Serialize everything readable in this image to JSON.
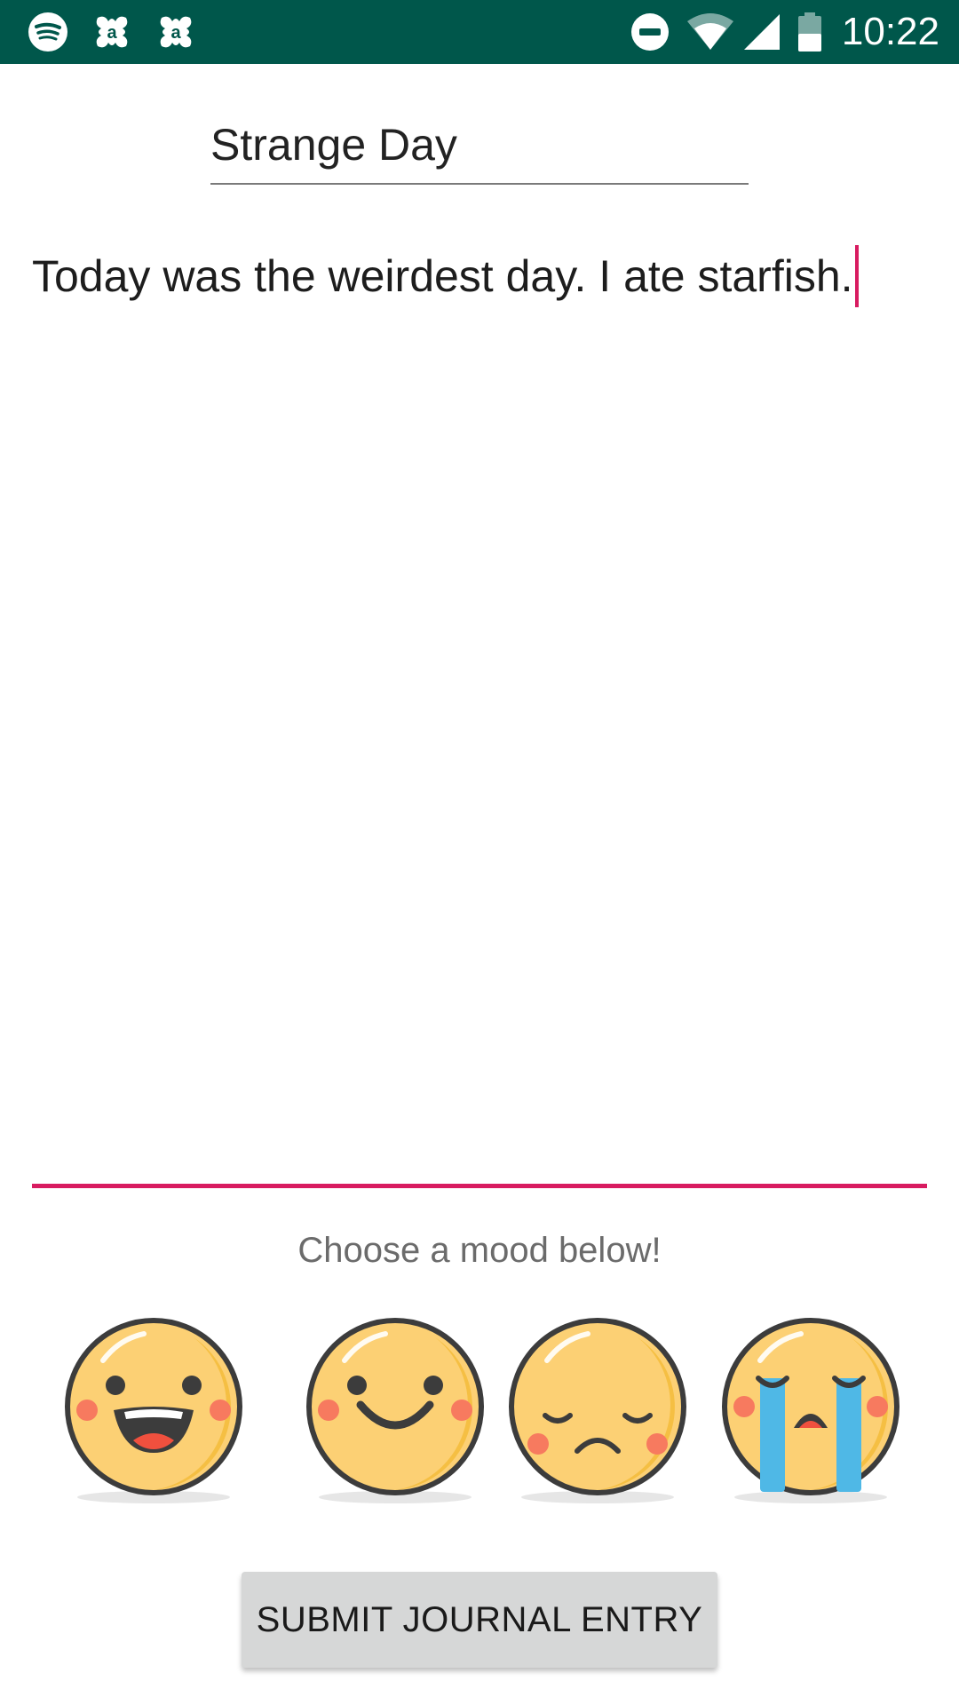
{
  "status_bar": {
    "time": "10:22",
    "left_icons": [
      "spotify-icon",
      "app-notification-icon",
      "app-notification-icon"
    ],
    "right_icons": [
      "do-not-disturb-icon",
      "wifi-icon",
      "cell-signal-icon",
      "battery-icon"
    ],
    "background": "#00574b"
  },
  "journal": {
    "title_value": "Strange Day",
    "body_value": "Today was the weirdest day. I ate starfish.",
    "accent_color": "#d81b60"
  },
  "mood": {
    "prompt": "Choose a mood below!",
    "options": [
      "very-happy-face-icon",
      "happy-face-icon",
      "sad-face-icon",
      "crying-face-icon"
    ]
  },
  "submit": {
    "label": "SUBMIT JOURNAL ENTRY"
  }
}
